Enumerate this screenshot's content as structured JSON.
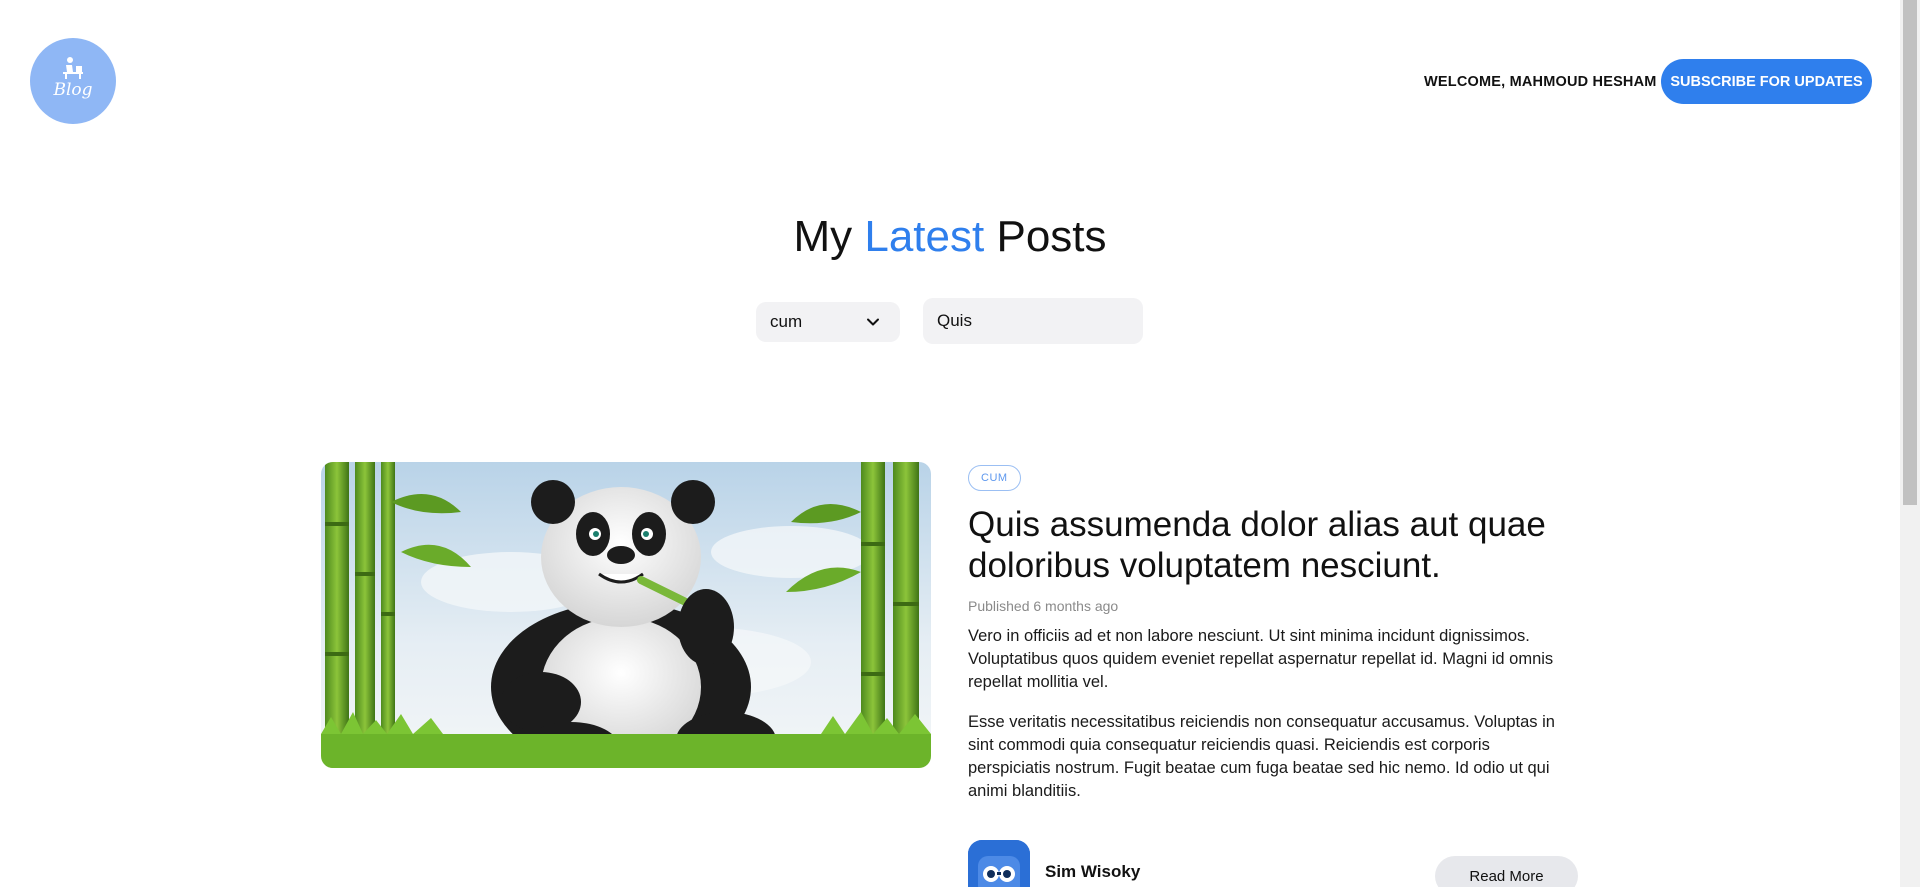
{
  "header": {
    "logo_text": "Blog",
    "welcome": "WELCOME, MAHMOUD HESHAM",
    "subscribe_label": "SUBSCRIBE FOR UPDATES"
  },
  "title": {
    "part1": "My",
    "accent": "Latest",
    "part2": "Posts"
  },
  "filters": {
    "category_selected": "cum",
    "search_value": "Quis"
  },
  "post": {
    "category": "CUM",
    "title": "Quis assumenda dolor alias aut quae doloribus voluptatem nesciunt.",
    "published": "Published 6 months ago",
    "excerpt_1": "Vero in officiis ad et non labore nesciunt. Ut sint minima incidunt dignissimos. Voluptatibus quos quidem eveniet repellat aspernatur repellat id. Magni id omnis repellat mollitia vel.",
    "excerpt_2": "Esse veritatis necessitatibus reiciendis non consequatur accusamus. Voluptas in sint commodi quia consequatur reiciendis quasi. Reiciendis est corporis perspiciatis nostrum. Fugit beatae cum fuga beatae sed hic nemo. Id odio ut qui animi blanditiis.",
    "author": "Sim Wisoky",
    "read_more_label": "Read More"
  },
  "colors": {
    "accent": "#2f7fed",
    "logo_bg": "#8fb7f5"
  },
  "icons": {
    "logo": "writer-at-desk-icon",
    "dropdown": "chevron-down-icon"
  }
}
